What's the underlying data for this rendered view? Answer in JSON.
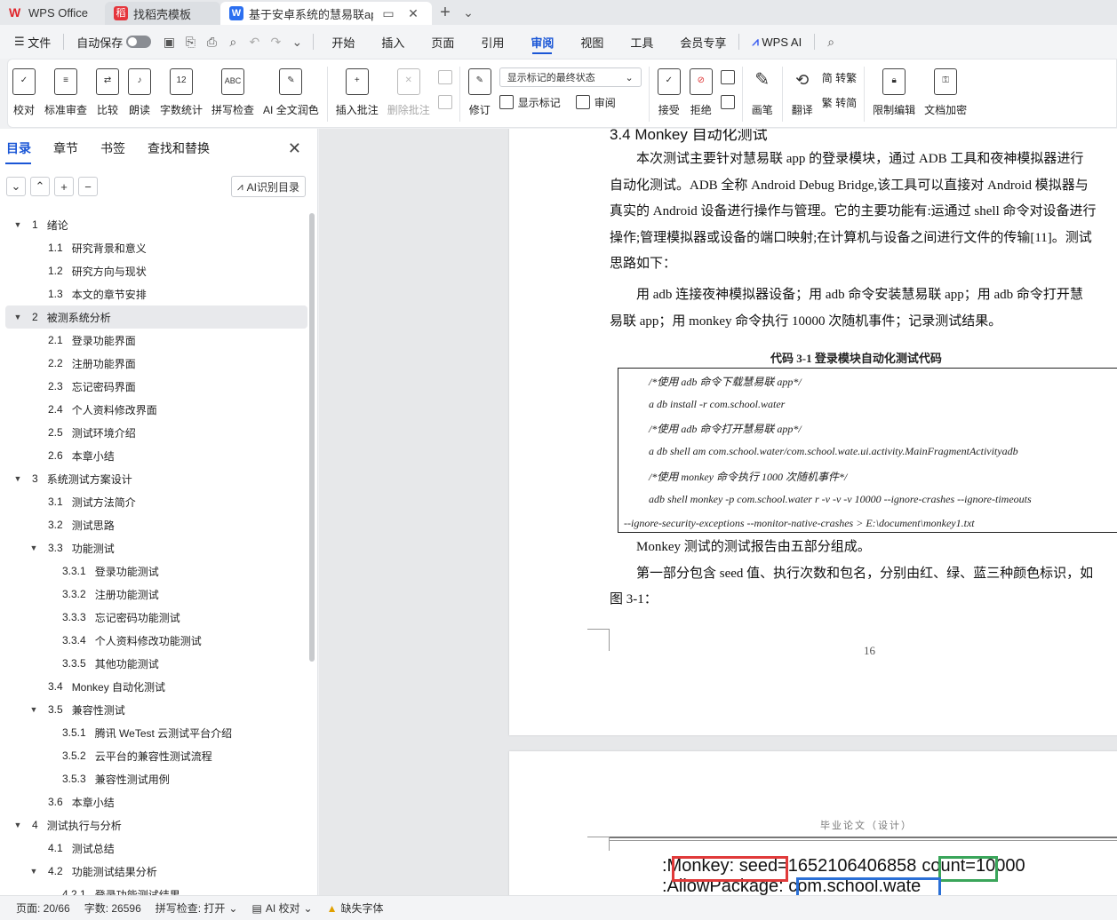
{
  "tabs": [
    {
      "label": "WPS Office"
    },
    {
      "label": "找稻壳模板"
    },
    {
      "label": "基于安卓系统的慧易联app的"
    }
  ],
  "menubar": {
    "file": "文件",
    "autosave": "自动保存",
    "items": [
      "开始",
      "插入",
      "页面",
      "引用",
      "审阅",
      "视图",
      "工具",
      "会员专享"
    ],
    "active": "审阅",
    "wps_ai": "WPS AI"
  },
  "ribbon": {
    "proof": "校对",
    "standard_review": "标准审查",
    "compare": "比较",
    "read_aloud": "朗读",
    "word_count": "字数统计",
    "spell_check": "拼写检查",
    "ai_color": "AI 全文润色",
    "insert_comment": "插入批注",
    "delete_comment": "删除批注",
    "revise": "修订",
    "markup_select": "显示标记的最终状态",
    "show_markup": "显示标记",
    "review": "审阅",
    "accept": "接受",
    "reject": "拒绝",
    "pen": "画笔",
    "translate": "翻译",
    "to_trad": "简 转繁",
    "to_simp": "繁 转简",
    "restrict": "限制编辑",
    "doc_encrypt": "文档加密"
  },
  "nav": {
    "tabs": [
      "目录",
      "章节",
      "书签",
      "查找和替换"
    ],
    "active_tab": "目录",
    "ai_toc": "AI识别目录",
    "toc": [
      {
        "level": 1,
        "arrow": "▼",
        "num": "1",
        "text": "绪论"
      },
      {
        "level": 2,
        "arrow": "",
        "num": "1.1",
        "text": "研究背景和意义"
      },
      {
        "level": 2,
        "arrow": "",
        "num": "1.2",
        "text": "研究方向与现状"
      },
      {
        "level": 2,
        "arrow": "",
        "num": "1.3",
        "text": "本文的章节安排"
      },
      {
        "level": 1,
        "arrow": "▼",
        "num": "2",
        "text": "被测系统分析",
        "selected": true
      },
      {
        "level": 2,
        "arrow": "",
        "num": "2.1",
        "text": "登录功能界面"
      },
      {
        "level": 2,
        "arrow": "",
        "num": "2.2",
        "text": "注册功能界面"
      },
      {
        "level": 2,
        "arrow": "",
        "num": "2.3",
        "text": "忘记密码界面"
      },
      {
        "level": 2,
        "arrow": "",
        "num": "2.4",
        "text": "个人资料修改界面"
      },
      {
        "level": 2,
        "arrow": "",
        "num": "2.5",
        "text": "测试环境介绍"
      },
      {
        "level": 2,
        "arrow": "",
        "num": "2.6",
        "text": "本章小结"
      },
      {
        "level": 1,
        "arrow": "▼",
        "num": "3",
        "text": "系统测试方案设计"
      },
      {
        "level": 2,
        "arrow": "",
        "num": "3.1",
        "text": "测试方法简介"
      },
      {
        "level": 2,
        "arrow": "",
        "num": "3.2",
        "text": "测试思路"
      },
      {
        "level": 2,
        "arrow": "▼",
        "num": "3.3",
        "text": "功能测试"
      },
      {
        "level": 3,
        "arrow": "",
        "num": "3.3.1",
        "text": "登录功能测试"
      },
      {
        "level": 3,
        "arrow": "",
        "num": "3.3.2",
        "text": "注册功能测试"
      },
      {
        "level": 3,
        "arrow": "",
        "num": "3.3.3",
        "text": "忘记密码功能测试"
      },
      {
        "level": 3,
        "arrow": "",
        "num": "3.3.4",
        "text": "个人资料修改功能测试"
      },
      {
        "level": 3,
        "arrow": "",
        "num": "3.3.5",
        "text": "其他功能测试"
      },
      {
        "level": 2,
        "arrow": "",
        "num": "3.4",
        "text": "Monkey 自动化测试"
      },
      {
        "level": 2,
        "arrow": "▼",
        "num": "3.5",
        "text": "兼容性测试"
      },
      {
        "level": 3,
        "arrow": "",
        "num": "3.5.1",
        "text": "腾讯 WeTest 云测试平台介绍"
      },
      {
        "level": 3,
        "arrow": "",
        "num": "3.5.2",
        "text": "云平台的兼容性测试流程"
      },
      {
        "level": 3,
        "arrow": "",
        "num": "3.5.3",
        "text": "兼容性测试用例"
      },
      {
        "level": 2,
        "arrow": "",
        "num": "3.6",
        "text": "本章小结"
      },
      {
        "level": 1,
        "arrow": "▼",
        "num": "4",
        "text": "测试执行与分析"
      },
      {
        "level": 2,
        "arrow": "",
        "num": "4.1",
        "text": "测试总结"
      },
      {
        "level": 2,
        "arrow": "▼",
        "num": "4.2",
        "text": "功能测试结果分析"
      },
      {
        "level": 3,
        "arrow": "",
        "num": "4.2.1",
        "text": "登录功能测试结果"
      }
    ]
  },
  "document": {
    "heading": "3.4   Monkey 自动化测试",
    "paragraphs": [
      "　　本次测试主要针对慧易联 app 的登录模块，通过 ADB 工具和夜神模拟器进行",
      "自动化测试。ADB 全称 Android Debug Bridge,该工具可以直接对 Android 模拟器与",
      "真实的 Android 设备进行操作与管理。它的主要功能有:运通过 shell 命令对设备进行",
      "操作;管理模拟器或设备的端口映射;在计算机与设备之间进行文件的传输[11]。测试",
      "思路如下："
    ],
    "paragraph2": [
      "　　用 adb 连接夜神模拟器设备；用 adb 命令安装慧易联 app；用 adb 命令打开慧",
      "易联 app；用 monkey 命令执行 10000 次随机事件；记录测试结果。"
    ],
    "caption": "代码 3-1  登录模块自动化测试代码",
    "code": [
      "/*使用 adb 命令下载慧易联 app*/",
      "a db install -r com.school.water",
      "/*使用 adb 命令打开慧易联 app*/",
      "a db shell am com.school.water/com.school.wate.ui.activity.MainFragmentActivityadb",
      "/*使用 monkey 命令执行 1000 次随机事件*/",
      "adb shell monkey -p com.school.water r -v -v -v 10000 --ignore-crashes --ignore-timeouts",
      "--ignore-security-exceptions --monitor-native-crashes > E:\\document\\monkey1.txt"
    ],
    "after_code": [
      "　　Monkey 测试的测试报告由五部分组成。",
      "　　第一部分包含 seed 值、执行次数和包名，分别由红、绿、蓝三种颜色标识，如",
      "图 3-1："
    ],
    "page_number": "16",
    "page2_header": "毕业论文（设计）",
    "monkey_line1_a": ":Monkey: seed",
    "monkey_line1_b": "=1652106406858",
    "monkey_line1_c": "count",
    "monkey_line1_d": "=10000",
    "monkey_line2_a": ":AllowPackage: ",
    "monkey_line2_b": "com.school.wate"
  },
  "status": {
    "page": "页面: 20/66",
    "words": "字数: 26596",
    "spell": "拼写检查: 打开",
    "ai_proof": "AI 校对",
    "missing_font": "缺失字体"
  },
  "colors": {
    "accent": "#1a56d6",
    "red_box": "#e03a3a",
    "green_box": "#3aa55a",
    "blue_box": "#2a6fd6"
  }
}
